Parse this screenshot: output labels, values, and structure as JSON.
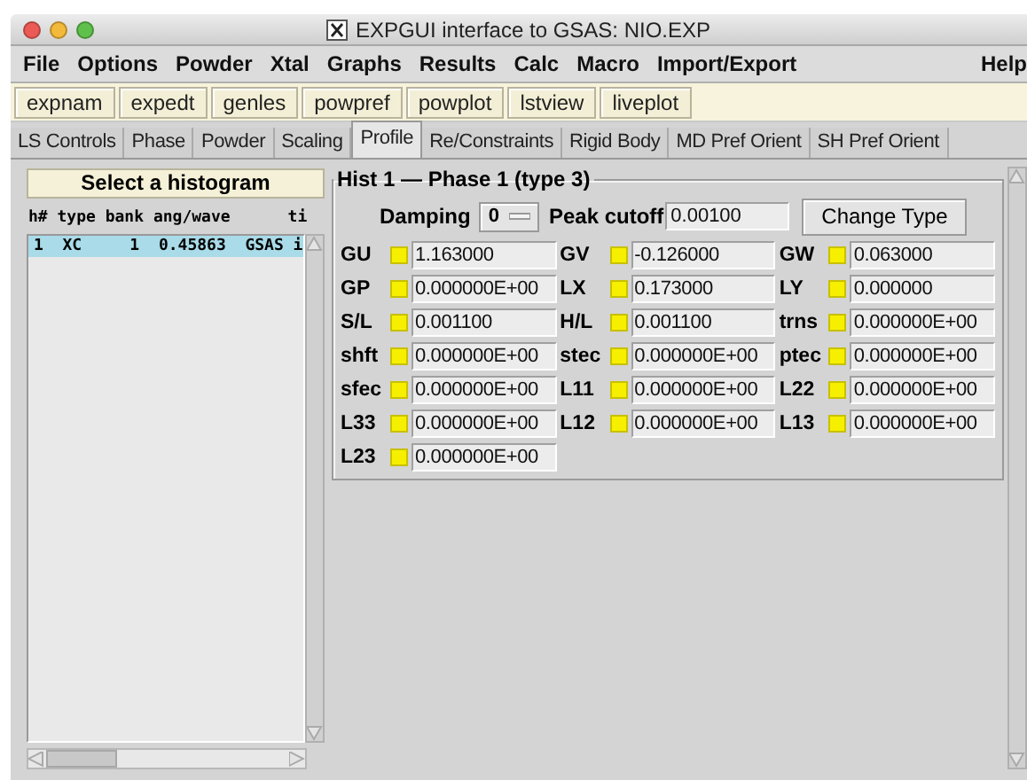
{
  "window": {
    "title": "EXPGUI interface to GSAS: NIO.EXP"
  },
  "menu": [
    "File",
    "Options",
    "Powder",
    "Xtal",
    "Graphs",
    "Results",
    "Calc",
    "Macro",
    "Import/Export",
    "Help"
  ],
  "toolbar": [
    "expnam",
    "expedt",
    "genles",
    "powpref",
    "powplot",
    "lstview",
    "liveplot"
  ],
  "tabs": [
    {
      "label": "LS Controls",
      "selected": false
    },
    {
      "label": "Phase",
      "selected": false
    },
    {
      "label": "Powder",
      "selected": false
    },
    {
      "label": "Scaling",
      "selected": false
    },
    {
      "label": "Profile",
      "selected": true
    },
    {
      "label": "Re/Constraints",
      "selected": false
    },
    {
      "label": "Rigid Body",
      "selected": false
    },
    {
      "label": "MD Pref Orient",
      "selected": false
    },
    {
      "label": "SH Pref Orient",
      "selected": false
    }
  ],
  "histogram_panel": {
    "title": "Select a histogram",
    "header": "h# type bank ang/wave      ti",
    "rows": [
      {
        "text": "1  XC     1  0.45863  GSAS i",
        "selected": true
      }
    ]
  },
  "profile": {
    "title": "Hist 1 — Phase 1 (type 3)",
    "damping": {
      "label": "Damping",
      "value": "0"
    },
    "peak_cutoff": {
      "label": "Peak cutoff",
      "value": "0.00100"
    },
    "change_type_button": "Change Type",
    "parameters": [
      {
        "label": "GU",
        "checked": true,
        "value": "1.163000"
      },
      {
        "label": "GV",
        "checked": true,
        "value": "-0.126000"
      },
      {
        "label": "GW",
        "checked": true,
        "value": "0.063000"
      },
      {
        "label": "GP",
        "checked": true,
        "value": "0.000000E+00"
      },
      {
        "label": "LX",
        "checked": true,
        "value": "0.173000"
      },
      {
        "label": "LY",
        "checked": true,
        "value": "0.000000"
      },
      {
        "label": "S/L",
        "checked": true,
        "value": "0.001100"
      },
      {
        "label": "H/L",
        "checked": true,
        "value": "0.001100"
      },
      {
        "label": "trns",
        "checked": true,
        "value": "0.000000E+00"
      },
      {
        "label": "shft",
        "checked": true,
        "value": "0.000000E+00"
      },
      {
        "label": "stec",
        "checked": true,
        "value": "0.000000E+00"
      },
      {
        "label": "ptec",
        "checked": true,
        "value": "0.000000E+00"
      },
      {
        "label": "sfec",
        "checked": true,
        "value": "0.000000E+00"
      },
      {
        "label": "L11",
        "checked": true,
        "value": "0.000000E+00"
      },
      {
        "label": "L22",
        "checked": true,
        "value": "0.000000E+00"
      },
      {
        "label": "L33",
        "checked": true,
        "value": "0.000000E+00"
      },
      {
        "label": "L12",
        "checked": true,
        "value": "0.000000E+00"
      },
      {
        "label": "L13",
        "checked": true,
        "value": "0.000000E+00"
      },
      {
        "label": "L23",
        "checked": true,
        "value": "0.000000E+00"
      }
    ]
  }
}
